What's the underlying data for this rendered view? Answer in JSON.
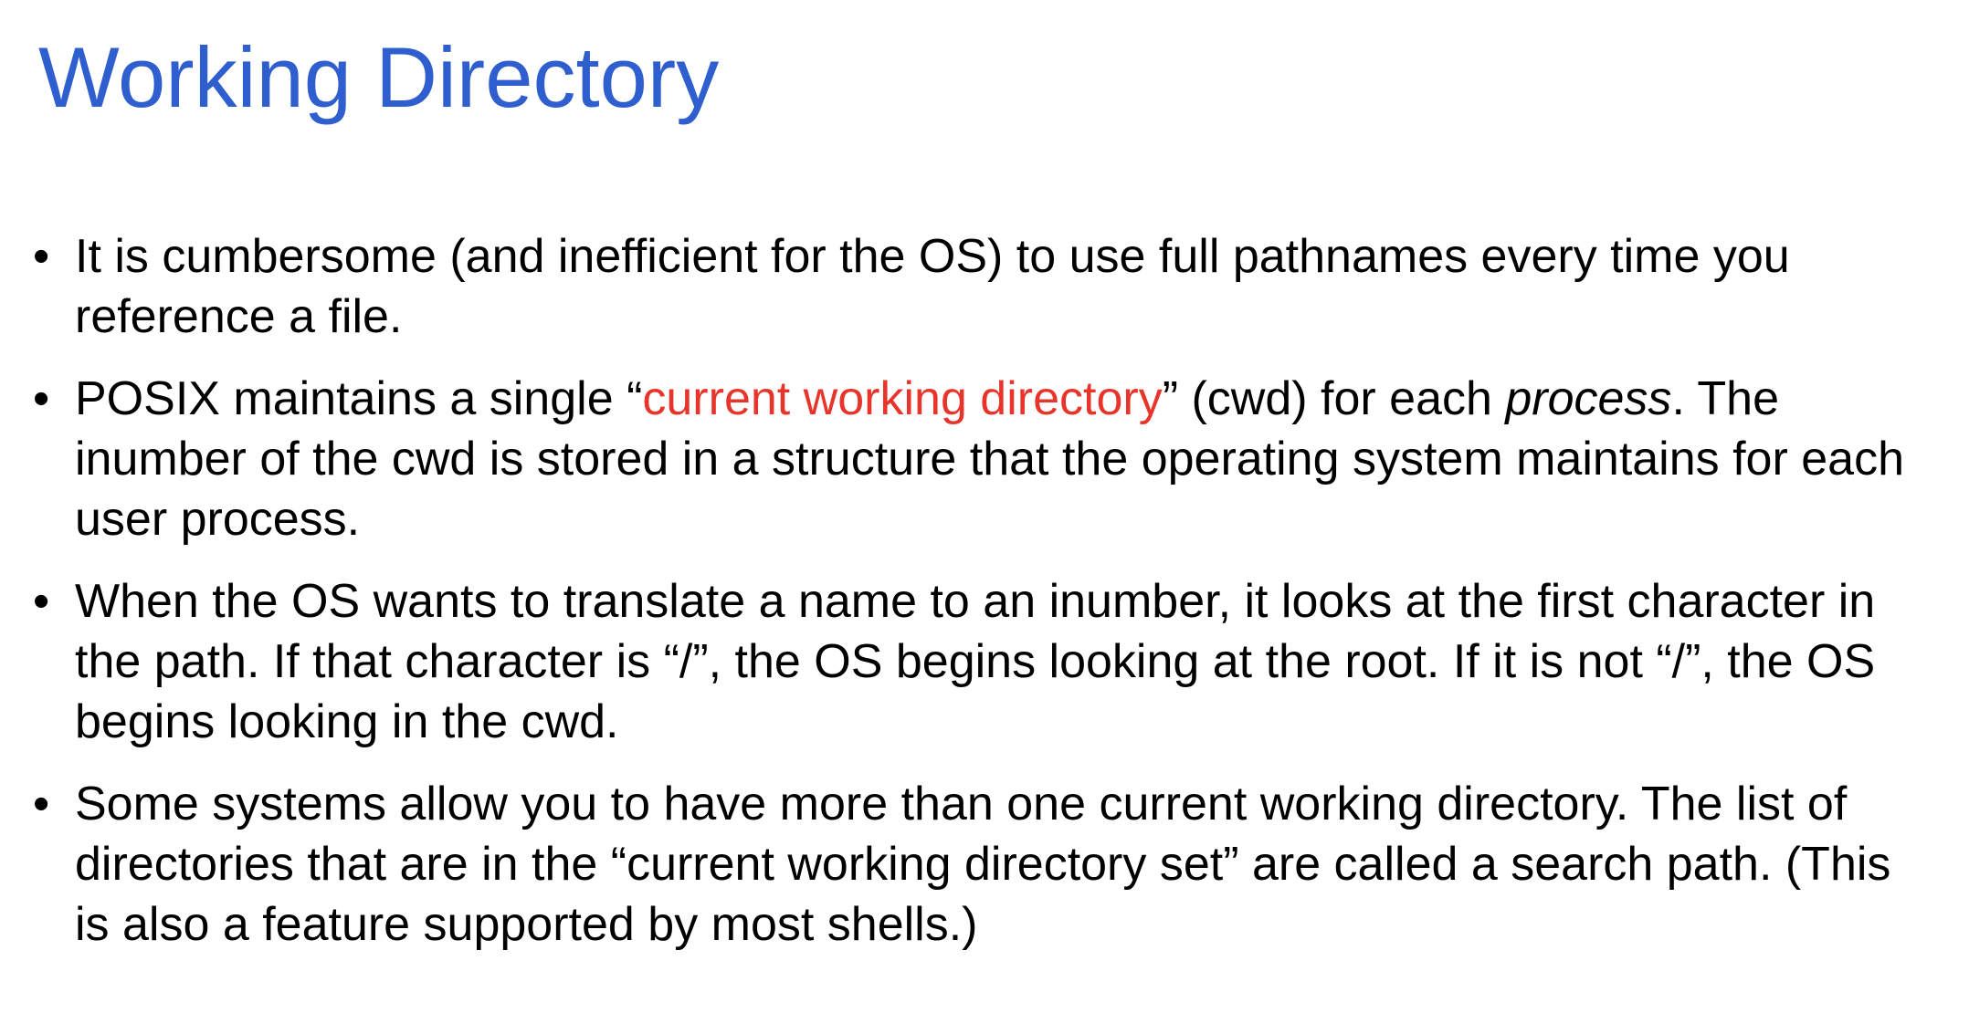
{
  "slide": {
    "title": "Working Directory",
    "bullet_marker": "•",
    "colors": {
      "title": "#2f5fcf",
      "highlight": "#e8352b",
      "text": "#000000",
      "background": "#ffffff"
    },
    "bullets": [
      {
        "text": "It is cumbersome (and inefficient for the OS) to use full pathnames every time you reference a file."
      },
      {
        "prefix": "POSIX maintains a single “",
        "highlight": "current working directory",
        "middle": "” (cwd) for each ",
        "emphasis": "process",
        "suffix": ". The inumber of the cwd is stored in a structure that the operating system maintains for each user process."
      },
      {
        "text": "When the OS wants to translate a name to an inumber, it looks at the first character in the path. If that character is “/”, the OS begins looking at the root. If it is not “/”, the OS begins looking in the cwd."
      },
      {
        "text": "Some systems allow you to have more than one current working directory. The list of directories that are in the “current working directory set” are called a search path. (This is also a feature supported by most shells.)"
      }
    ]
  }
}
